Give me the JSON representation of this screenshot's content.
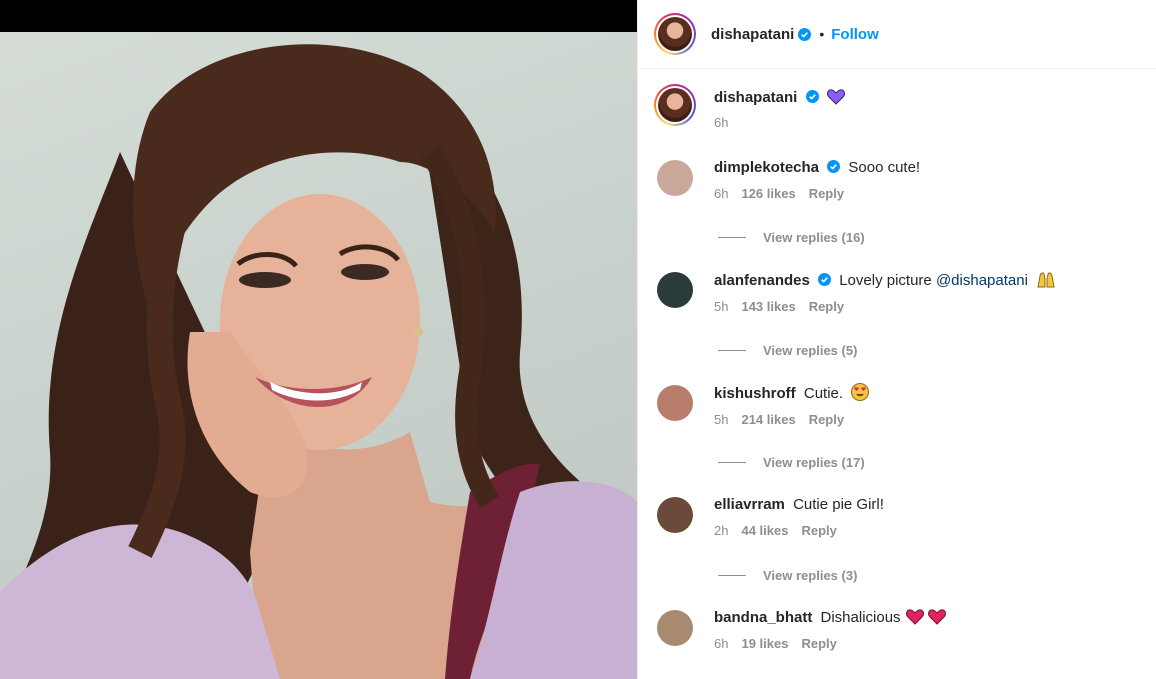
{
  "header": {
    "username": "dishapatani",
    "dot": "•",
    "follow_label": "Follow"
  },
  "caption": {
    "username": "dishapatani",
    "emoji": "purple-heart",
    "time": "6h"
  },
  "comments": [
    {
      "username": "dimplekotecha",
      "verified": true,
      "text": "Sooo cute!",
      "time": "6h",
      "likes": "126 likes",
      "reply_label": "Reply",
      "view_replies": "View replies (16)",
      "avatar_color": "#c9a89a"
    },
    {
      "username": "alanfenandes",
      "verified": true,
      "text": "Lovely picture",
      "mention": "@dishapatani",
      "emoji": "raising-hands",
      "time": "5h",
      "likes": "143 likes",
      "reply_label": "Reply",
      "view_replies": "View replies (5)",
      "avatar_color": "#2b3a3a"
    },
    {
      "username": "kishushroff",
      "verified": false,
      "text": "Cutie.",
      "emoji": "heart-eyes",
      "time": "5h",
      "likes": "214 likes",
      "reply_label": "Reply",
      "view_replies": "View replies (17)",
      "avatar_color": "#b77d6a"
    },
    {
      "username": "elliavrram",
      "verified": false,
      "text": "Cutie pie Girl!",
      "time": "2h",
      "likes": "44 likes",
      "reply_label": "Reply",
      "view_replies": "View replies (3)",
      "avatar_color": "#6b4a3c"
    },
    {
      "username": "bandna_bhatt",
      "verified": false,
      "text": "Dishalicious",
      "emoji": "red-hearts",
      "time": "6h",
      "likes": "19 likes",
      "reply_label": "Reply",
      "avatar_color": "#a88a70"
    }
  ],
  "colors": {
    "accent": "#0095f6",
    "secondary_text": "#8e8e8e",
    "mention": "#00376b",
    "sweater": "#cdb6d6"
  }
}
